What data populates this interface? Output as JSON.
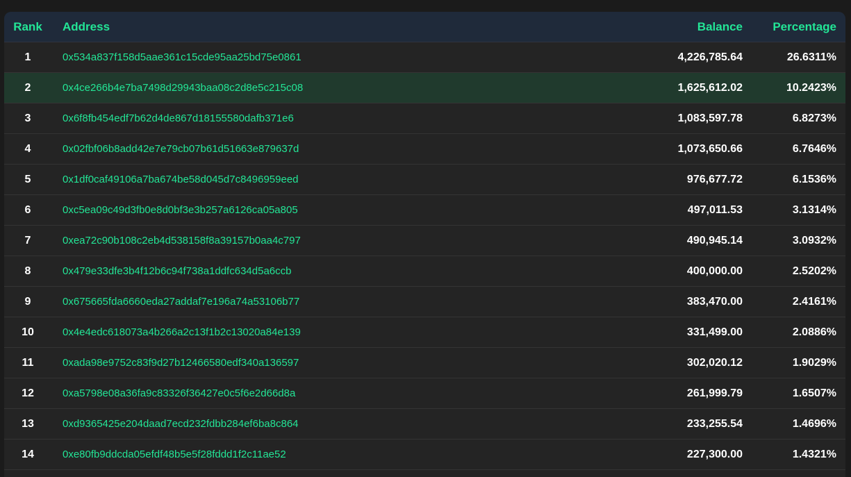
{
  "table": {
    "headers": {
      "rank": "Rank",
      "address": "Address",
      "balance": "Balance",
      "percentage": "Percentage"
    },
    "highlight_color": "#203a2d",
    "accent_color": "#23e596",
    "rows": [
      {
        "rank": "1",
        "address": "0x534a837f158d5aae361c15cde95aa25bd75e0861",
        "balance": "4,226,785.64",
        "percentage": "26.6311%"
      },
      {
        "rank": "2",
        "address": "0x4ce266b4e7ba7498d29943baa08c2d8e5c215c08",
        "balance": "1,625,612.02",
        "percentage": "10.2423%"
      },
      {
        "rank": "3",
        "address": "0x6f8fb454edf7b62d4de867d18155580dafb371e6",
        "balance": "1,083,597.78",
        "percentage": "6.8273%"
      },
      {
        "rank": "4",
        "address": "0x02fbf06b8add42e7e79cb07b61d51663e879637d",
        "balance": "1,073,650.66",
        "percentage": "6.7646%"
      },
      {
        "rank": "5",
        "address": "0x1df0caf49106a7ba674be58d045d7c8496959eed",
        "balance": "976,677.72",
        "percentage": "6.1536%"
      },
      {
        "rank": "6",
        "address": "0xc5ea09c49d3fb0e8d0bf3e3b257a6126ca05a805",
        "balance": "497,011.53",
        "percentage": "3.1314%"
      },
      {
        "rank": "7",
        "address": "0xea72c90b108c2eb4d538158f8a39157b0aa4c797",
        "balance": "490,945.14",
        "percentage": "3.0932%"
      },
      {
        "rank": "8",
        "address": "0x479e33dfe3b4f12b6c94f738a1ddfc634d5a6ccb",
        "balance": "400,000.00",
        "percentage": "2.5202%"
      },
      {
        "rank": "9",
        "address": "0x675665fda6660eda27addaf7e196a74a53106b77",
        "balance": "383,470.00",
        "percentage": "2.4161%"
      },
      {
        "rank": "10",
        "address": "0x4e4edc618073a4b266a2c13f1b2c13020a84e139",
        "balance": "331,499.00",
        "percentage": "2.0886%"
      },
      {
        "rank": "11",
        "address": "0xada98e9752c83f9d27b12466580edf340a136597",
        "balance": "302,020.12",
        "percentage": "1.9029%"
      },
      {
        "rank": "12",
        "address": "0xa5798e08a36fa9c83326f36427e0c5f6e2d66d8a",
        "balance": "261,999.79",
        "percentage": "1.6507%"
      },
      {
        "rank": "13",
        "address": "0xd9365425e204daad7ecd232fdbb284ef6ba8c864",
        "balance": "233,255.54",
        "percentage": "1.4696%"
      },
      {
        "rank": "14",
        "address": "0xe80fb9ddcda05efdf48b5e5f28fddd1f2c11ae52",
        "balance": "227,300.00",
        "percentage": "1.4321%"
      }
    ]
  }
}
